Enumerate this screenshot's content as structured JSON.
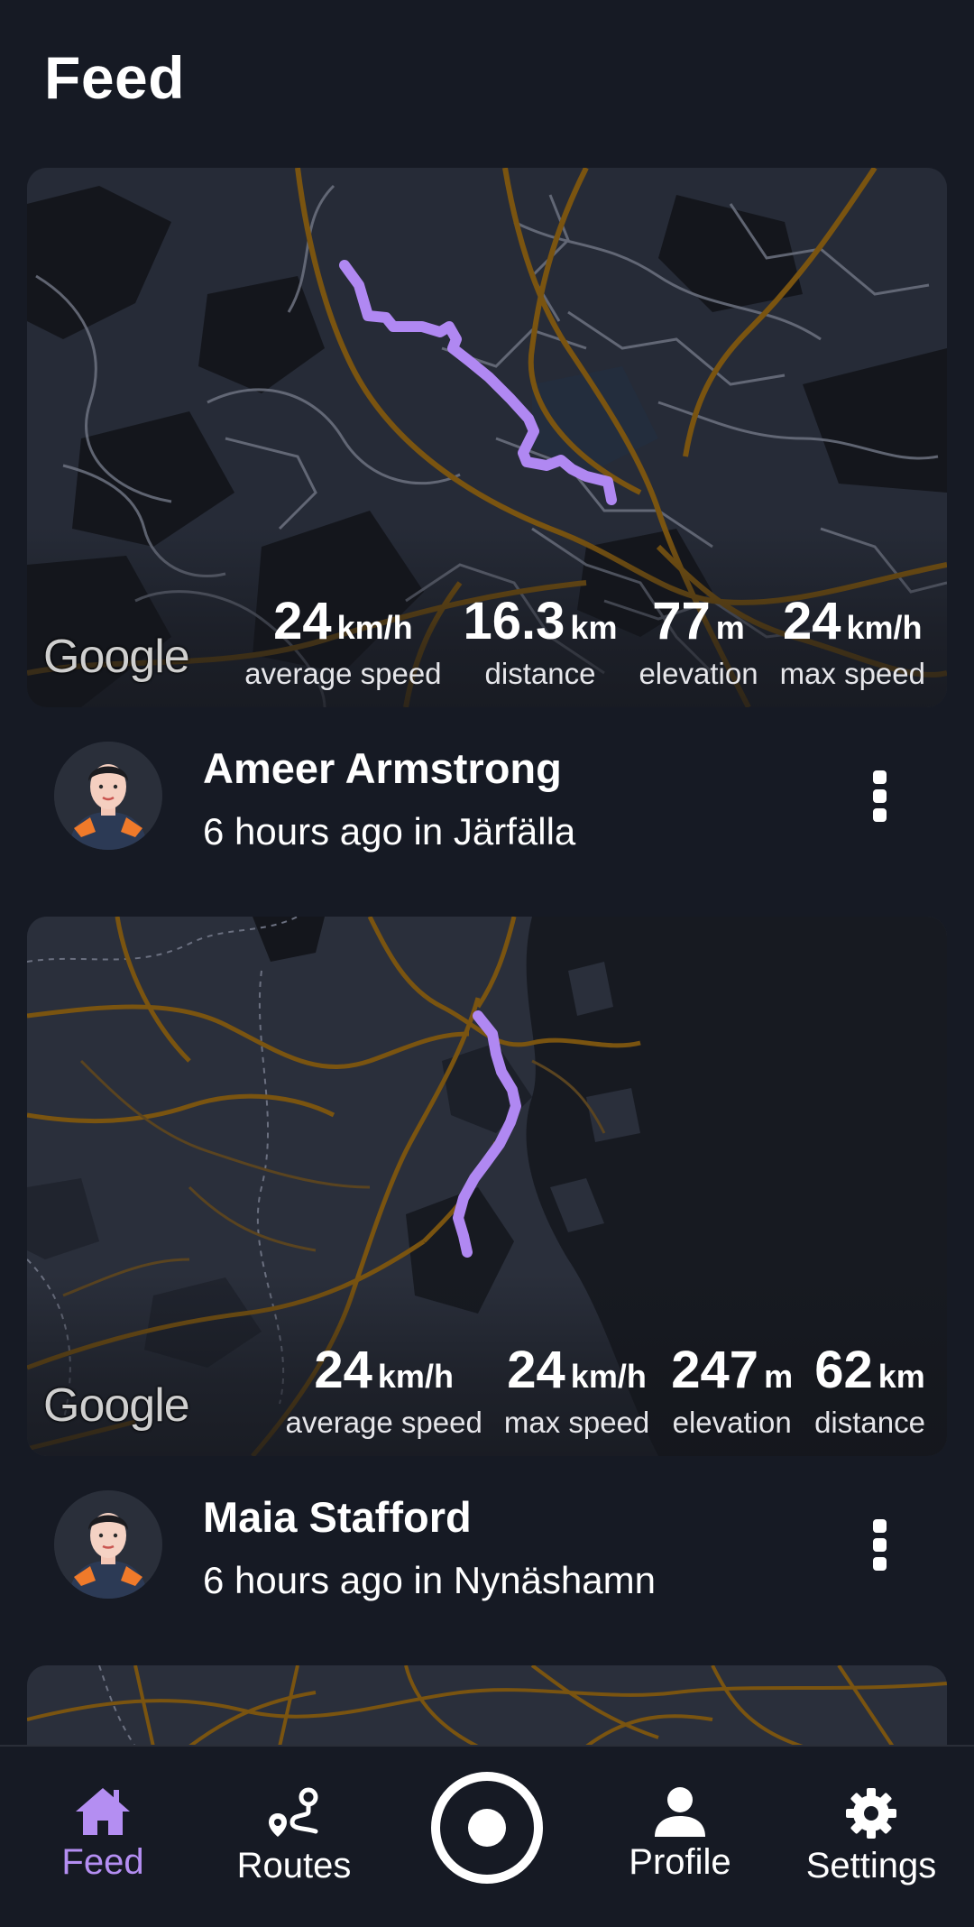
{
  "header": {
    "title": "Feed"
  },
  "colors": {
    "accent": "#b48ef2",
    "route": "#b088f2",
    "road": "#7a5410",
    "background": "#161a24"
  },
  "feed": [
    {
      "map_attribution": "Google",
      "stats": [
        {
          "value": "24",
          "unit": "km/h",
          "label": "average speed"
        },
        {
          "value": "16.3",
          "unit": "km",
          "label": "distance"
        },
        {
          "value": "77",
          "unit": "m",
          "label": "elevation"
        },
        {
          "value": "24",
          "unit": "km/h",
          "label": "max speed"
        }
      ],
      "user": {
        "name": "Ameer Armstrong",
        "meta": "6 hours ago in Järfälla"
      }
    },
    {
      "map_attribution": "Google",
      "stats": [
        {
          "value": "24",
          "unit": "km/h",
          "label": "average speed"
        },
        {
          "value": "24",
          "unit": "km/h",
          "label": "max speed"
        },
        {
          "value": "247",
          "unit": "m",
          "label": "elevation"
        },
        {
          "value": "62",
          "unit": "km",
          "label": "distance"
        }
      ],
      "user": {
        "name": "Maia Stafford",
        "meta": "6 hours ago in Nynäshamn"
      }
    }
  ],
  "nav": {
    "items": [
      {
        "label": "Feed",
        "icon": "home-icon",
        "active": true
      },
      {
        "label": "Routes",
        "icon": "route-icon"
      },
      {
        "label": "",
        "icon": "record-icon"
      },
      {
        "label": "Profile",
        "icon": "person-icon"
      },
      {
        "label": "Settings",
        "icon": "gear-icon"
      }
    ]
  }
}
